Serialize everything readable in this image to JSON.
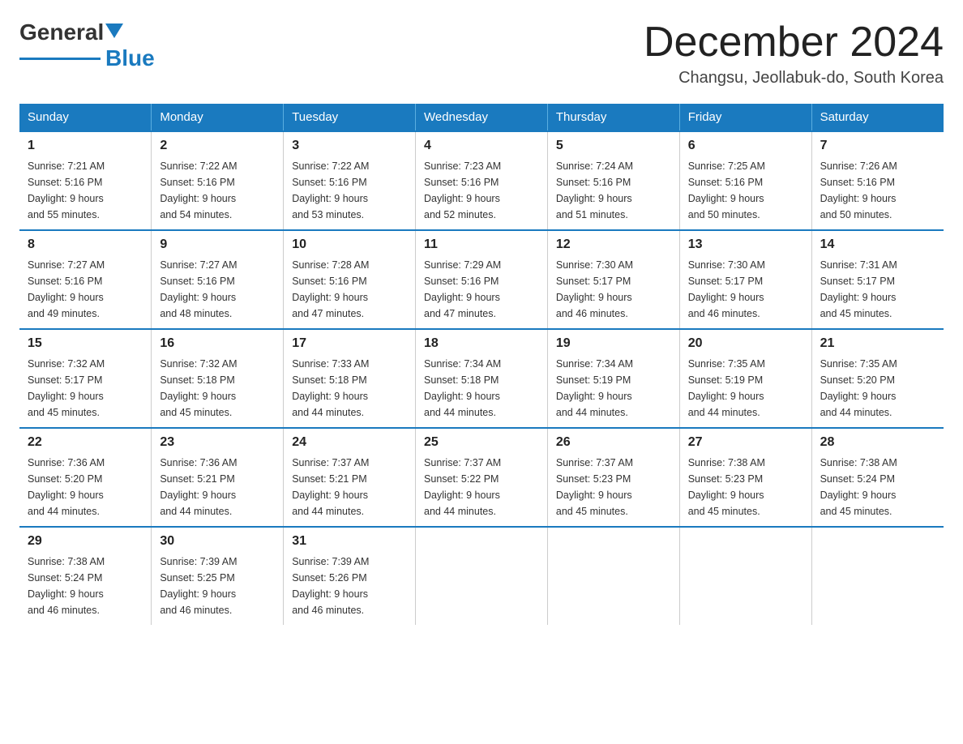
{
  "header": {
    "logo_line1": "General",
    "logo_line2": "Blue",
    "month_title": "December 2024",
    "location": "Changsu, Jeollabuk-do, South Korea"
  },
  "days_of_week": [
    "Sunday",
    "Monday",
    "Tuesday",
    "Wednesday",
    "Thursday",
    "Friday",
    "Saturday"
  ],
  "weeks": [
    [
      {
        "day": "1",
        "sunrise": "7:21 AM",
        "sunset": "5:16 PM",
        "daylight": "9 hours and 55 minutes."
      },
      {
        "day": "2",
        "sunrise": "7:22 AM",
        "sunset": "5:16 PM",
        "daylight": "9 hours and 54 minutes."
      },
      {
        "day": "3",
        "sunrise": "7:22 AM",
        "sunset": "5:16 PM",
        "daylight": "9 hours and 53 minutes."
      },
      {
        "day": "4",
        "sunrise": "7:23 AM",
        "sunset": "5:16 PM",
        "daylight": "9 hours and 52 minutes."
      },
      {
        "day": "5",
        "sunrise": "7:24 AM",
        "sunset": "5:16 PM",
        "daylight": "9 hours and 51 minutes."
      },
      {
        "day": "6",
        "sunrise": "7:25 AM",
        "sunset": "5:16 PM",
        "daylight": "9 hours and 50 minutes."
      },
      {
        "day": "7",
        "sunrise": "7:26 AM",
        "sunset": "5:16 PM",
        "daylight": "9 hours and 50 minutes."
      }
    ],
    [
      {
        "day": "8",
        "sunrise": "7:27 AM",
        "sunset": "5:16 PM",
        "daylight": "9 hours and 49 minutes."
      },
      {
        "day": "9",
        "sunrise": "7:27 AM",
        "sunset": "5:16 PM",
        "daylight": "9 hours and 48 minutes."
      },
      {
        "day": "10",
        "sunrise": "7:28 AM",
        "sunset": "5:16 PM",
        "daylight": "9 hours and 47 minutes."
      },
      {
        "day": "11",
        "sunrise": "7:29 AM",
        "sunset": "5:16 PM",
        "daylight": "9 hours and 47 minutes."
      },
      {
        "day": "12",
        "sunrise": "7:30 AM",
        "sunset": "5:17 PM",
        "daylight": "9 hours and 46 minutes."
      },
      {
        "day": "13",
        "sunrise": "7:30 AM",
        "sunset": "5:17 PM",
        "daylight": "9 hours and 46 minutes."
      },
      {
        "day": "14",
        "sunrise": "7:31 AM",
        "sunset": "5:17 PM",
        "daylight": "9 hours and 45 minutes."
      }
    ],
    [
      {
        "day": "15",
        "sunrise": "7:32 AM",
        "sunset": "5:17 PM",
        "daylight": "9 hours and 45 minutes."
      },
      {
        "day": "16",
        "sunrise": "7:32 AM",
        "sunset": "5:18 PM",
        "daylight": "9 hours and 45 minutes."
      },
      {
        "day": "17",
        "sunrise": "7:33 AM",
        "sunset": "5:18 PM",
        "daylight": "9 hours and 44 minutes."
      },
      {
        "day": "18",
        "sunrise": "7:34 AM",
        "sunset": "5:18 PM",
        "daylight": "9 hours and 44 minutes."
      },
      {
        "day": "19",
        "sunrise": "7:34 AM",
        "sunset": "5:19 PM",
        "daylight": "9 hours and 44 minutes."
      },
      {
        "day": "20",
        "sunrise": "7:35 AM",
        "sunset": "5:19 PM",
        "daylight": "9 hours and 44 minutes."
      },
      {
        "day": "21",
        "sunrise": "7:35 AM",
        "sunset": "5:20 PM",
        "daylight": "9 hours and 44 minutes."
      }
    ],
    [
      {
        "day": "22",
        "sunrise": "7:36 AM",
        "sunset": "5:20 PM",
        "daylight": "9 hours and 44 minutes."
      },
      {
        "day": "23",
        "sunrise": "7:36 AM",
        "sunset": "5:21 PM",
        "daylight": "9 hours and 44 minutes."
      },
      {
        "day": "24",
        "sunrise": "7:37 AM",
        "sunset": "5:21 PM",
        "daylight": "9 hours and 44 minutes."
      },
      {
        "day": "25",
        "sunrise": "7:37 AM",
        "sunset": "5:22 PM",
        "daylight": "9 hours and 44 minutes."
      },
      {
        "day": "26",
        "sunrise": "7:37 AM",
        "sunset": "5:23 PM",
        "daylight": "9 hours and 45 minutes."
      },
      {
        "day": "27",
        "sunrise": "7:38 AM",
        "sunset": "5:23 PM",
        "daylight": "9 hours and 45 minutes."
      },
      {
        "day": "28",
        "sunrise": "7:38 AM",
        "sunset": "5:24 PM",
        "daylight": "9 hours and 45 minutes."
      }
    ],
    [
      {
        "day": "29",
        "sunrise": "7:38 AM",
        "sunset": "5:24 PM",
        "daylight": "9 hours and 46 minutes."
      },
      {
        "day": "30",
        "sunrise": "7:39 AM",
        "sunset": "5:25 PM",
        "daylight": "9 hours and 46 minutes."
      },
      {
        "day": "31",
        "sunrise": "7:39 AM",
        "sunset": "5:26 PM",
        "daylight": "9 hours and 46 minutes."
      },
      null,
      null,
      null,
      null
    ]
  ],
  "labels": {
    "sunrise": "Sunrise:",
    "sunset": "Sunset:",
    "daylight": "Daylight:"
  }
}
